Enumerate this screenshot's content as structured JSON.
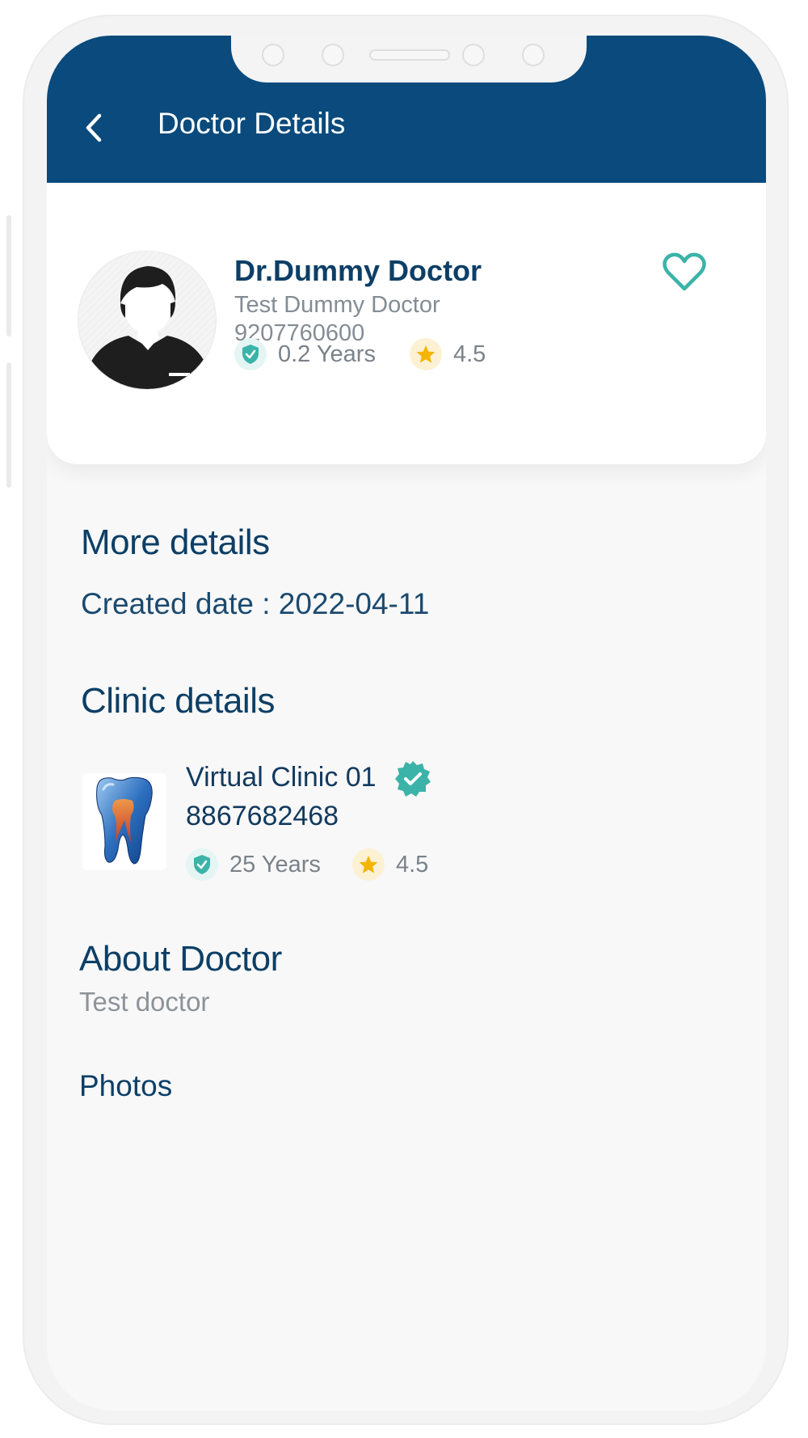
{
  "header": {
    "title": "Doctor Details",
    "back_icon": "chevron-left-icon",
    "background_color": "#0a4a7c"
  },
  "doctor": {
    "name": "Dr.Dummy Doctor",
    "specialty": "Test Dummy Doctor",
    "phone": "9207760600",
    "experience": "0.2 Years",
    "rating": "4.5",
    "favorite_icon": "heart-outline-icon",
    "avatar_icon": "user-avatar-icon"
  },
  "more_details": {
    "title": "More details",
    "created_date": "Created date : 2022-04-11"
  },
  "clinic": {
    "section_title": "Clinic details",
    "name": "Virtual Clinic 01",
    "phone": "8867682468",
    "experience": "25 Years",
    "rating": "4.5",
    "verified_icon": "verified-badge-icon",
    "image_icon": "tooth-icon"
  },
  "about": {
    "title": "About Doctor",
    "text": "Test doctor"
  },
  "photos": {
    "title": "Photos"
  },
  "colors": {
    "primary": "#0a4a7c",
    "accent_teal": "#3bb3a8",
    "star_gold": "#f5b400",
    "text_dark": "#0d3f66",
    "text_muted": "#848c94"
  }
}
